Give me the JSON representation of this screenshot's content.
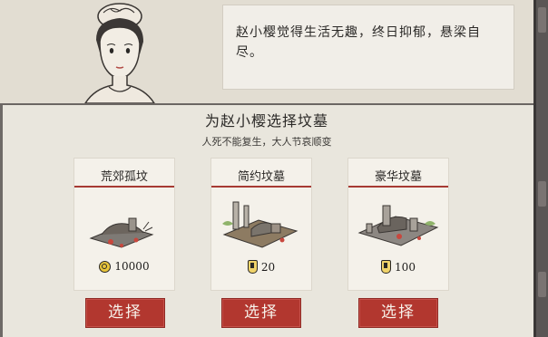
{
  "dialogue": {
    "text": "赵小樱觉得生活无趣，终日抑郁，悬梁自尽。"
  },
  "heading": {
    "title": "为赵小樱选择坟墓",
    "subtitle": "人死不能复生，大人节哀顺变"
  },
  "graves": [
    {
      "name": "荒郊孤坟",
      "price": "10000",
      "currency_icon": "coin-icon"
    },
    {
      "name": "简约坟墓",
      "price": "20",
      "currency_icon": "token-icon"
    },
    {
      "name": "豪华坟墓",
      "price": "100",
      "currency_icon": "token-icon"
    }
  ],
  "actions": {
    "select_label": "选择"
  },
  "colors": {
    "accent": "#b2372f",
    "paper": "#e9e6dd"
  }
}
